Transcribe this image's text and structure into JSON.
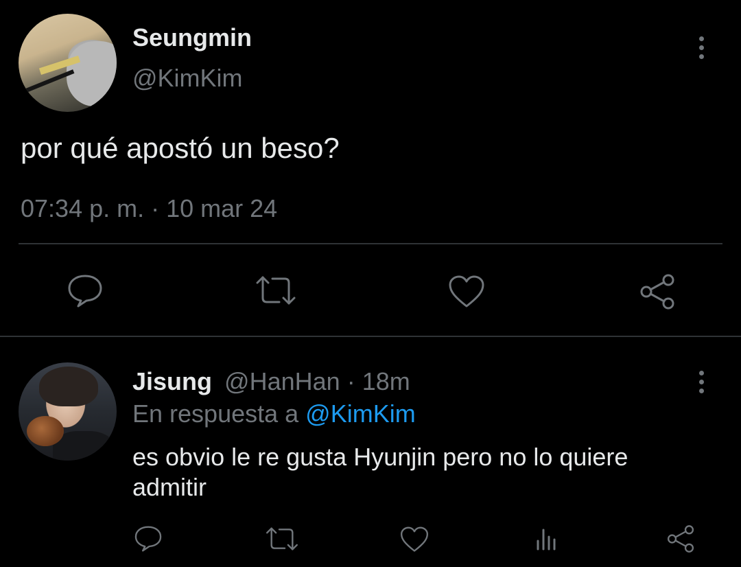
{
  "main_tweet": {
    "author_name": "Seungmin",
    "handle": "@KimKim",
    "text": "por qué apostó un beso?",
    "timestamp": "07:34 p. m. · 10 mar 24",
    "actions": [
      "reply-icon",
      "retweet-icon",
      "like-icon",
      "share-icon"
    ]
  },
  "reply": {
    "author_name": "Jisung",
    "handle": "@HanHan",
    "time_sep": "·",
    "time": "18m",
    "replying_to_label": "En respuesta a",
    "replying_to_handle": "@KimKim",
    "text": "es obvio le re gusta Hyunjin pero no lo quiere admitir",
    "actions": [
      "reply-icon",
      "retweet-icon",
      "like-icon",
      "analytics-icon",
      "share-icon"
    ]
  },
  "colors": {
    "background": "#000000",
    "text": "#e7e9ea",
    "muted": "#71767b",
    "link": "#1d9bf0",
    "divider": "#2f3336"
  }
}
